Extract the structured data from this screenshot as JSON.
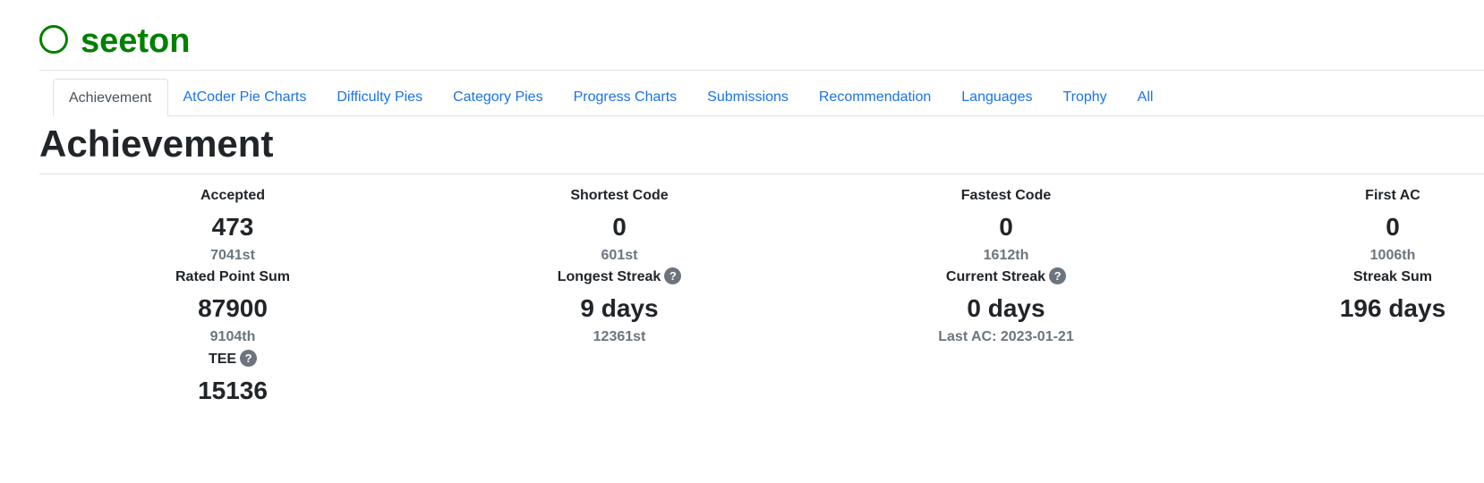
{
  "user": {
    "name": "seeton",
    "rating_color": "#008000"
  },
  "tabs": [
    {
      "label": "Achievement",
      "active": true
    },
    {
      "label": "AtCoder Pie Charts"
    },
    {
      "label": "Difficulty Pies"
    },
    {
      "label": "Category Pies"
    },
    {
      "label": "Progress Charts"
    },
    {
      "label": "Submissions"
    },
    {
      "label": "Recommendation"
    },
    {
      "label": "Languages"
    },
    {
      "label": "Trophy"
    },
    {
      "label": "All"
    }
  ],
  "section": {
    "title": "Achievement"
  },
  "stats": {
    "accepted": {
      "label": "Accepted",
      "value": "473",
      "sub": "7041st"
    },
    "shortest_code": {
      "label": "Shortest Code",
      "value": "0",
      "sub": "601st"
    },
    "fastest_code": {
      "label": "Fastest Code",
      "value": "0",
      "sub": "1612th"
    },
    "first_ac": {
      "label": "First AC",
      "value": "0",
      "sub": "1006th"
    },
    "rated_point_sum": {
      "label": "Rated Point Sum",
      "value": "87900",
      "sub": "9104th"
    },
    "longest_streak": {
      "label": "Longest Streak",
      "value": "9 days",
      "sub": "12361st"
    },
    "current_streak": {
      "label": "Current Streak",
      "value": "0 days",
      "sub": "Last AC: 2023-01-21"
    },
    "streak_sum": {
      "label": "Streak Sum",
      "value": "196 days"
    },
    "tee": {
      "label": "TEE",
      "value": "15136"
    }
  },
  "help_glyph": "?"
}
